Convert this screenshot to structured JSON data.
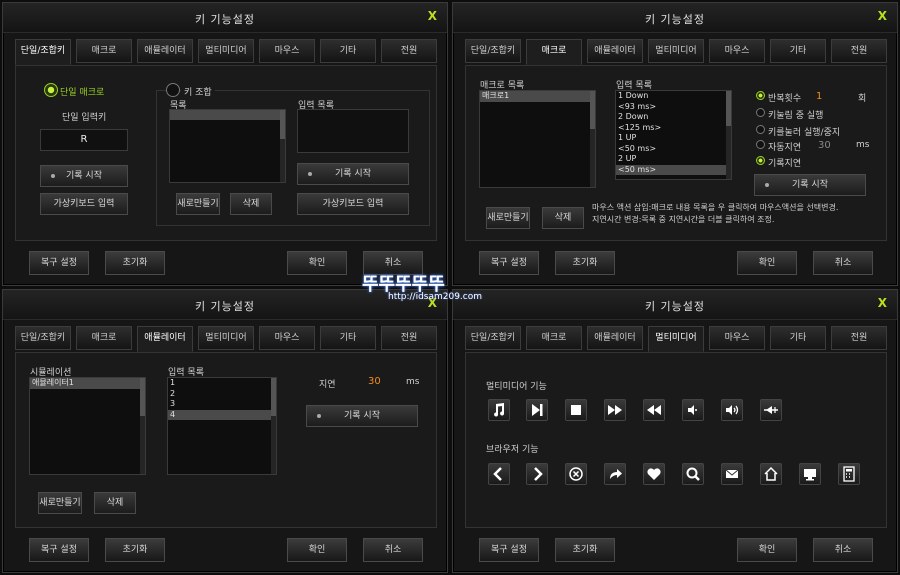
{
  "window_title": "키 기능설정",
  "close_label": "X",
  "tabs": [
    "단일/조합키",
    "매크로",
    "애뮬레이터",
    "멀티미디어",
    "마우스",
    "기타",
    "전원"
  ],
  "footer": {
    "restore": "복구 설정",
    "reset": "초기화",
    "ok": "확인",
    "cancel": "취소"
  },
  "w1": {
    "single_macro": "단일 매크로",
    "single_input": "단일 입력키",
    "single_value": "R",
    "record_start": "기록 시작",
    "virtual_kb": "가상키보드 입력",
    "key_combo": "키 조합",
    "list_label": "목록",
    "input_list_label": "입력 목록",
    "new": "새로만들기",
    "delete": "삭제",
    "record_start2": "기록 시작",
    "virtual_kb2": "가상키보드 입력"
  },
  "w2": {
    "macro_list_label": "매크로 목록",
    "macro_items": [
      "매크로1"
    ],
    "input_list_label": "입력 목록",
    "input_items": [
      "1 Down",
      "<93 ms>",
      "2 Down",
      "<125 ms>",
      "1 UP",
      "<50 ms>",
      "2 UP",
      "<50 ms>"
    ],
    "opt_repeat": "반복횟수",
    "repeat_value": "1",
    "repeat_unit": "회",
    "opt_while_pressed": "키눌림 중 실행",
    "opt_toggle": "키를눌러 실행/중지",
    "opt_auto_delay": "자동지연",
    "auto_delay_value": "30",
    "delay_unit": "ms",
    "opt_record_delay": "기록지연",
    "record_start": "기록 시작",
    "new": "새로만들기",
    "delete": "삭제",
    "help_line1": "마우스 액션 삽입:매크로 내용 목록을 우 클릭하여 마우스액션을 선택변경.",
    "help_line2": "지연시간 변경:목록 중 지연시간을 더블 클릭하여 조정."
  },
  "w3": {
    "sim_label": "시뮬레이션",
    "sim_items": [
      "애뮬레이터1"
    ],
    "input_list_label": "입력 목록",
    "input_items": [
      "1",
      "2",
      "3",
      "4"
    ],
    "delay_label": "지연",
    "delay_value": "30",
    "delay_unit": "ms",
    "record_start": "기록 시작",
    "new": "새로만들기",
    "delete": "삭제"
  },
  "w4": {
    "multimedia_label": "멀티미디어 기능",
    "browser_label": "브라우저 기능",
    "multimedia_icons": [
      "music-icon",
      "play-next-icon",
      "stop-icon",
      "fast-forward-icon",
      "rewind-icon",
      "volume-down-icon",
      "volume-up-icon",
      "mute-icon"
    ],
    "browser_icons": [
      "back-icon",
      "forward-icon",
      "stop-load-icon",
      "refresh-icon",
      "favorites-icon",
      "search-icon",
      "mail-icon",
      "home-icon",
      "my-computer-icon",
      "calculator-icon"
    ]
  },
  "watermark": {
    "logo": "뚜뚜뚜뚜뚜",
    "url": "http://idsam209.com"
  },
  "colors": {
    "accent_green": "#9ad020",
    "accent_orange": "#f08a20"
  }
}
